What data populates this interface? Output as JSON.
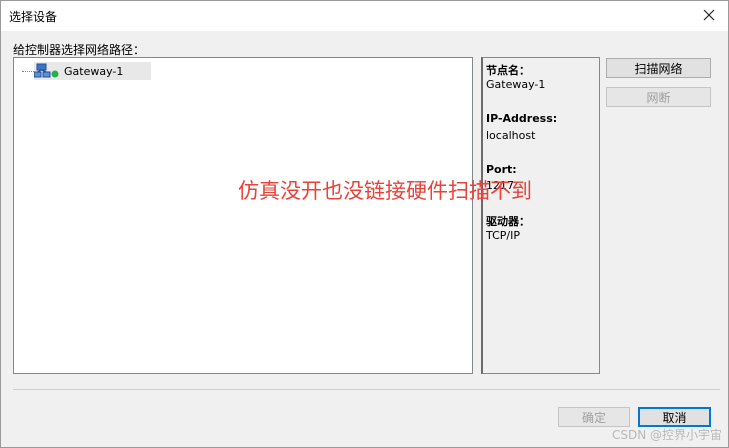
{
  "window": {
    "title": "选择设备",
    "close_icon": "close-icon"
  },
  "prompt": "给控制器选择网络路径：",
  "tree": {
    "nodes": [
      {
        "label": "Gateway-1",
        "icon": "network-gateway-icon",
        "status": "online"
      }
    ]
  },
  "info": {
    "node_name_label": "节点名：",
    "node_name_value": "Gateway-1",
    "ip_label": "IP-Address:",
    "ip_value": "localhost",
    "port_label": "Port:",
    "port_value": "1217",
    "driver_label": "驱动器：",
    "driver_value": "TCP/IP"
  },
  "buttons": {
    "scan": "扫描网络",
    "ping": "网断",
    "ok": "确定",
    "cancel": "取消"
  },
  "annotation": "仿真没开也没链接硬件扫描不到",
  "watermark": "CSDN @控界小宇宙",
  "colors": {
    "annotation": "#e8423a",
    "status_online": "#22b14c",
    "default_button_border": "#0078d7"
  }
}
